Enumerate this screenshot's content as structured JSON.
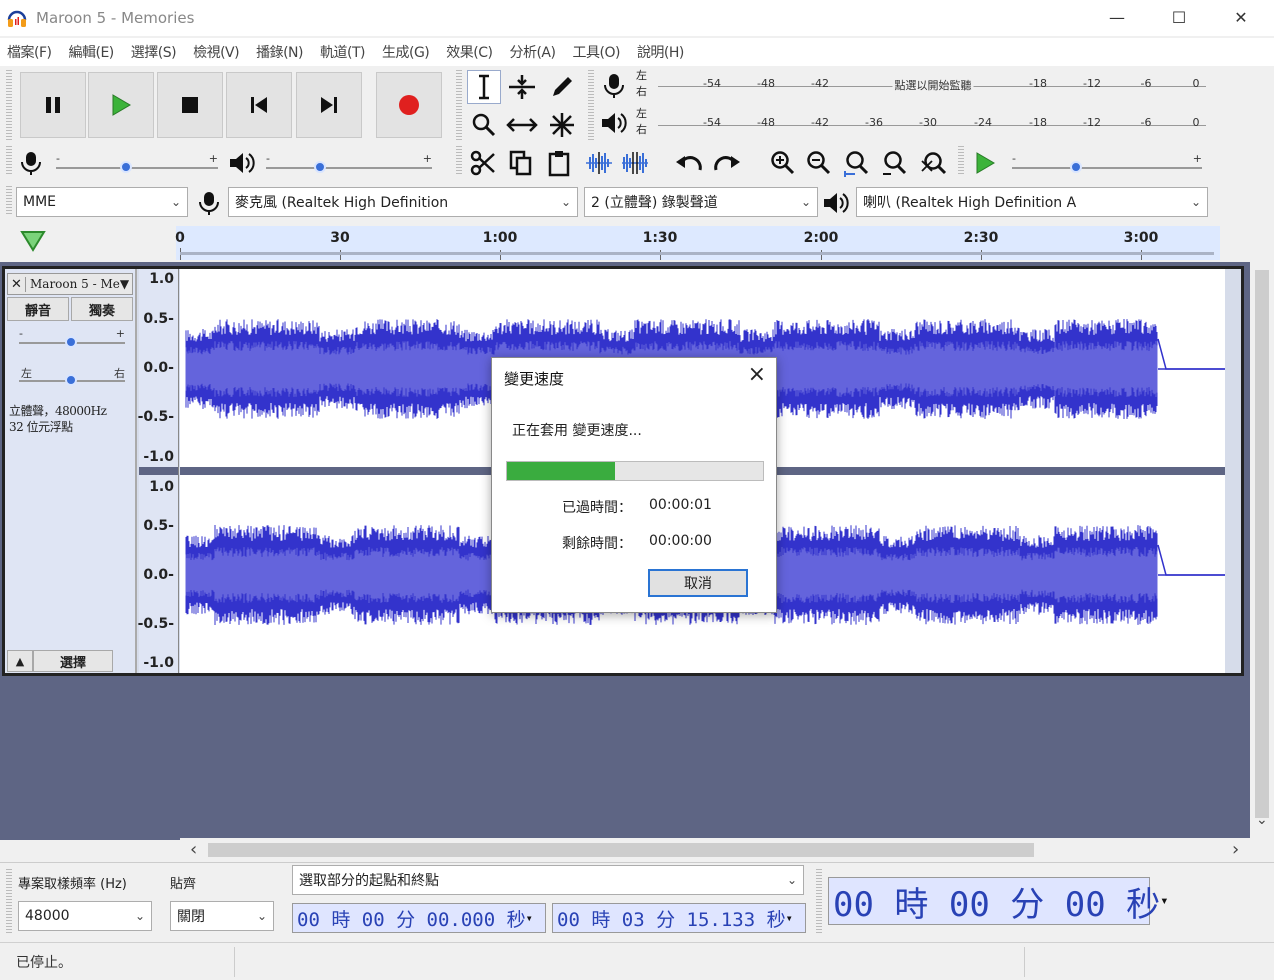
{
  "window": {
    "title": "Maroon 5 - Memories",
    "minimize": "—",
    "maximize": "☐",
    "close": "✕"
  },
  "menu": [
    "檔案(F)",
    "編輯(E)",
    "選擇(S)",
    "檢視(V)",
    "播錄(N)",
    "軌道(T)",
    "生成(G)",
    "效果(C)",
    "分析(A)",
    "工具(O)",
    "說明(H)"
  ],
  "meters": {
    "record_lr": [
      "左",
      "右"
    ],
    "play_lr": [
      "左",
      "右"
    ],
    "record_ticks": [
      "-54",
      "-48",
      "-42",
      "點選以開始監聽",
      "-18",
      "-12",
      "-6",
      "0"
    ],
    "play_ticks": [
      "-54",
      "-48",
      "-42",
      "-36",
      "-30",
      "-24",
      "-18",
      "-12",
      "-6",
      "0"
    ]
  },
  "slider_signs": {
    "minus": "-",
    "plus": "+"
  },
  "device": {
    "host": "MME",
    "input": "麥克風 (Realtek High Definition",
    "channels": "2 (立體聲) 錄製聲道",
    "output": "喇叭 (Realtek High Definition A"
  },
  "ruler": {
    "labels": [
      "0",
      "30",
      "1:00",
      "1:30",
      "2:00",
      "2:30",
      "3:00"
    ]
  },
  "track": {
    "name": "Maroon 5 - Me▼",
    "close": "✕",
    "mute": "靜音",
    "solo": "獨奏",
    "pan_left": "左",
    "pan_right": "右",
    "info_line1": "立體聲，48000Hz",
    "info_line2": "32 位元浮點",
    "collapse": "▲",
    "select": "選擇",
    "scale": [
      "1.0",
      "0.5-",
      "0.0-",
      "-0.5-",
      "-1.0"
    ]
  },
  "scroll": {
    "left": "‹",
    "right": "›",
    "down": "⌄"
  },
  "selection": {
    "rate_label": "專案取樣頻率 (Hz)",
    "snap_label": "貼齊",
    "rate_value": "48000",
    "snap_value": "關閉",
    "mode": "選取部分的起點和終點",
    "start": "00 時 00 分 00.000 秒",
    "end": "00 時 03 分 15.133 秒",
    "position": "00 時 00 分 00 秒"
  },
  "status": "已停止。",
  "dialog": {
    "title": "變更速度",
    "message": "正在套用 變更速度...",
    "progress": 0.42,
    "elapsed_label": "已過時間：",
    "elapsed_value": "00:00:01",
    "remaining_label": "剩餘時間：",
    "remaining_value": "00:00:00",
    "cancel": "取消"
  },
  "colors": {
    "waveform": "#3333cc",
    "waveform_rms": "#6464dc",
    "record": "#e0201f",
    "play": "#3cb33a",
    "progress": "#3aac3f",
    "timecode": "#2942b5"
  }
}
